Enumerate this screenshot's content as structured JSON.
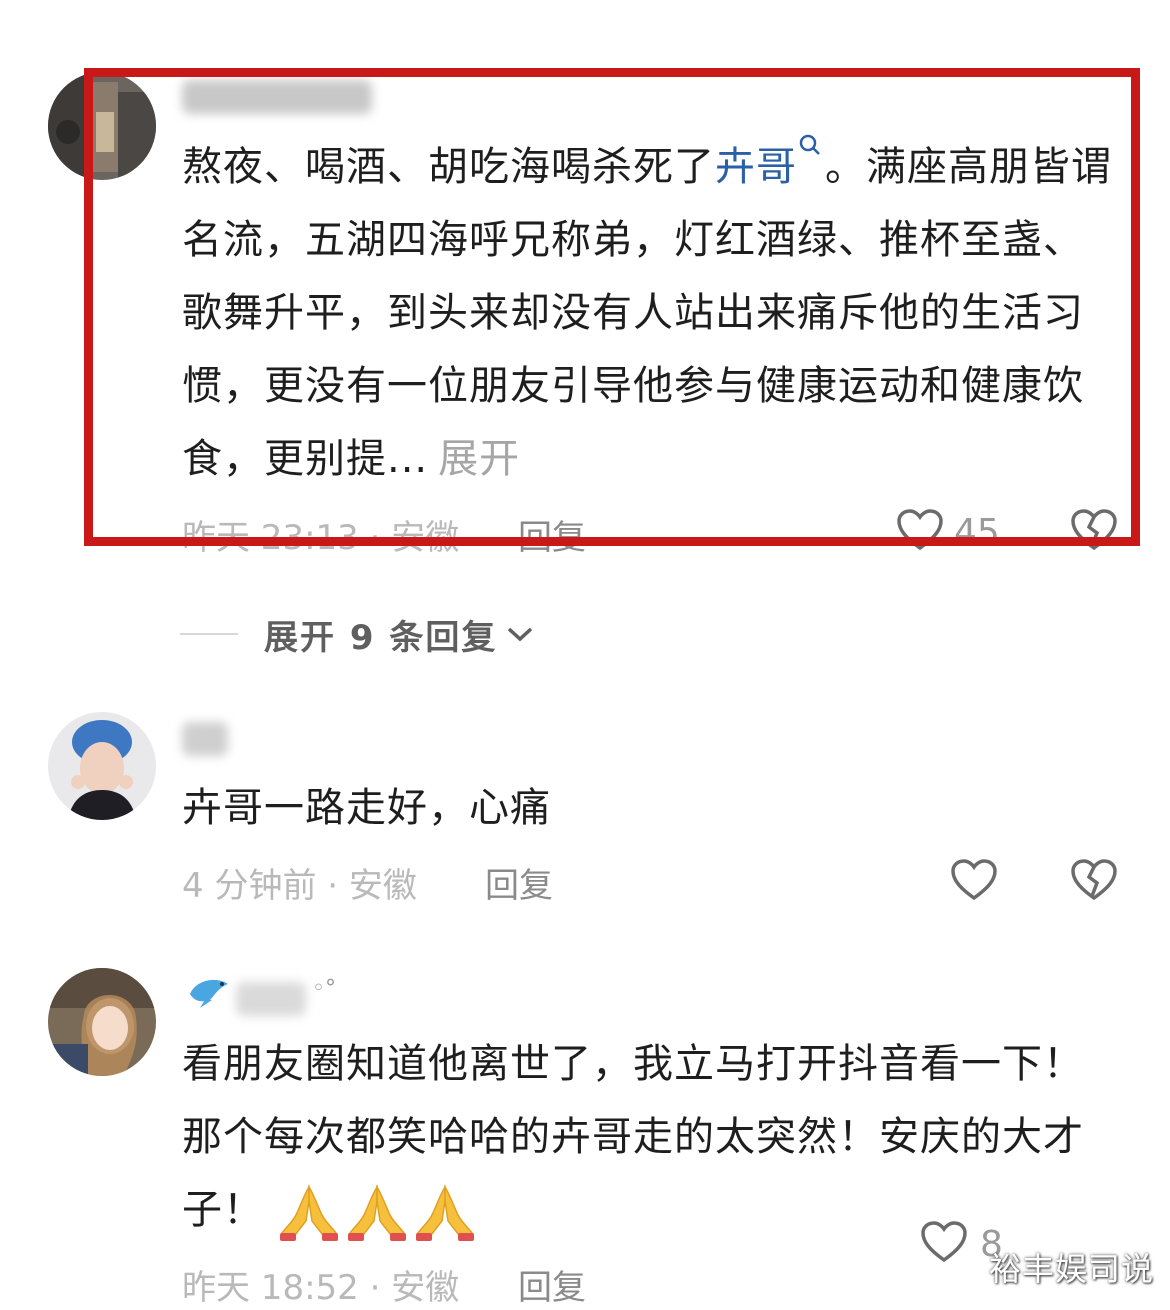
{
  "comments": [
    {
      "text_pre": "熬夜、喝酒、胡吃海喝杀死了",
      "hashtag": "卉哥",
      "text_post": "。满座高朋皆谓名流，五湖四海呼兄称弟，灯红酒绿、推杯至盏、歌舞升平，到头来却没有人站出来痛斥他的生活习惯，更没有一位朋友引导他参与健康运动和健康饮食，更别提...",
      "expand_label": "展开",
      "meta": "昨天 23:13 · 安徽",
      "reply_label": "回复",
      "like_count": "45"
    },
    {
      "text": "卉哥一路走好，心痛",
      "meta": "4 分钟前 · 安徽",
      "reply_label": "回复"
    },
    {
      "text": "看朋友圈知道他离世了，我立马打开抖音看一下！那个每次都笑哈哈的卉哥走的太突然！安庆的大才子！",
      "meta": "昨天 18:52 · 安徽",
      "reply_label": "回复",
      "like_count": "8"
    }
  ],
  "expand_replies_label": "展开 9 条回复",
  "watermark": "裕丰娱司说",
  "icons": [
    "search-icon",
    "heart-icon",
    "broken-heart-icon",
    "chevron-down-icon",
    "pray-emoji"
  ],
  "colors": {
    "highlight": "#c81818",
    "link": "#2b5fa6",
    "meta": "#b9b9b9"
  }
}
